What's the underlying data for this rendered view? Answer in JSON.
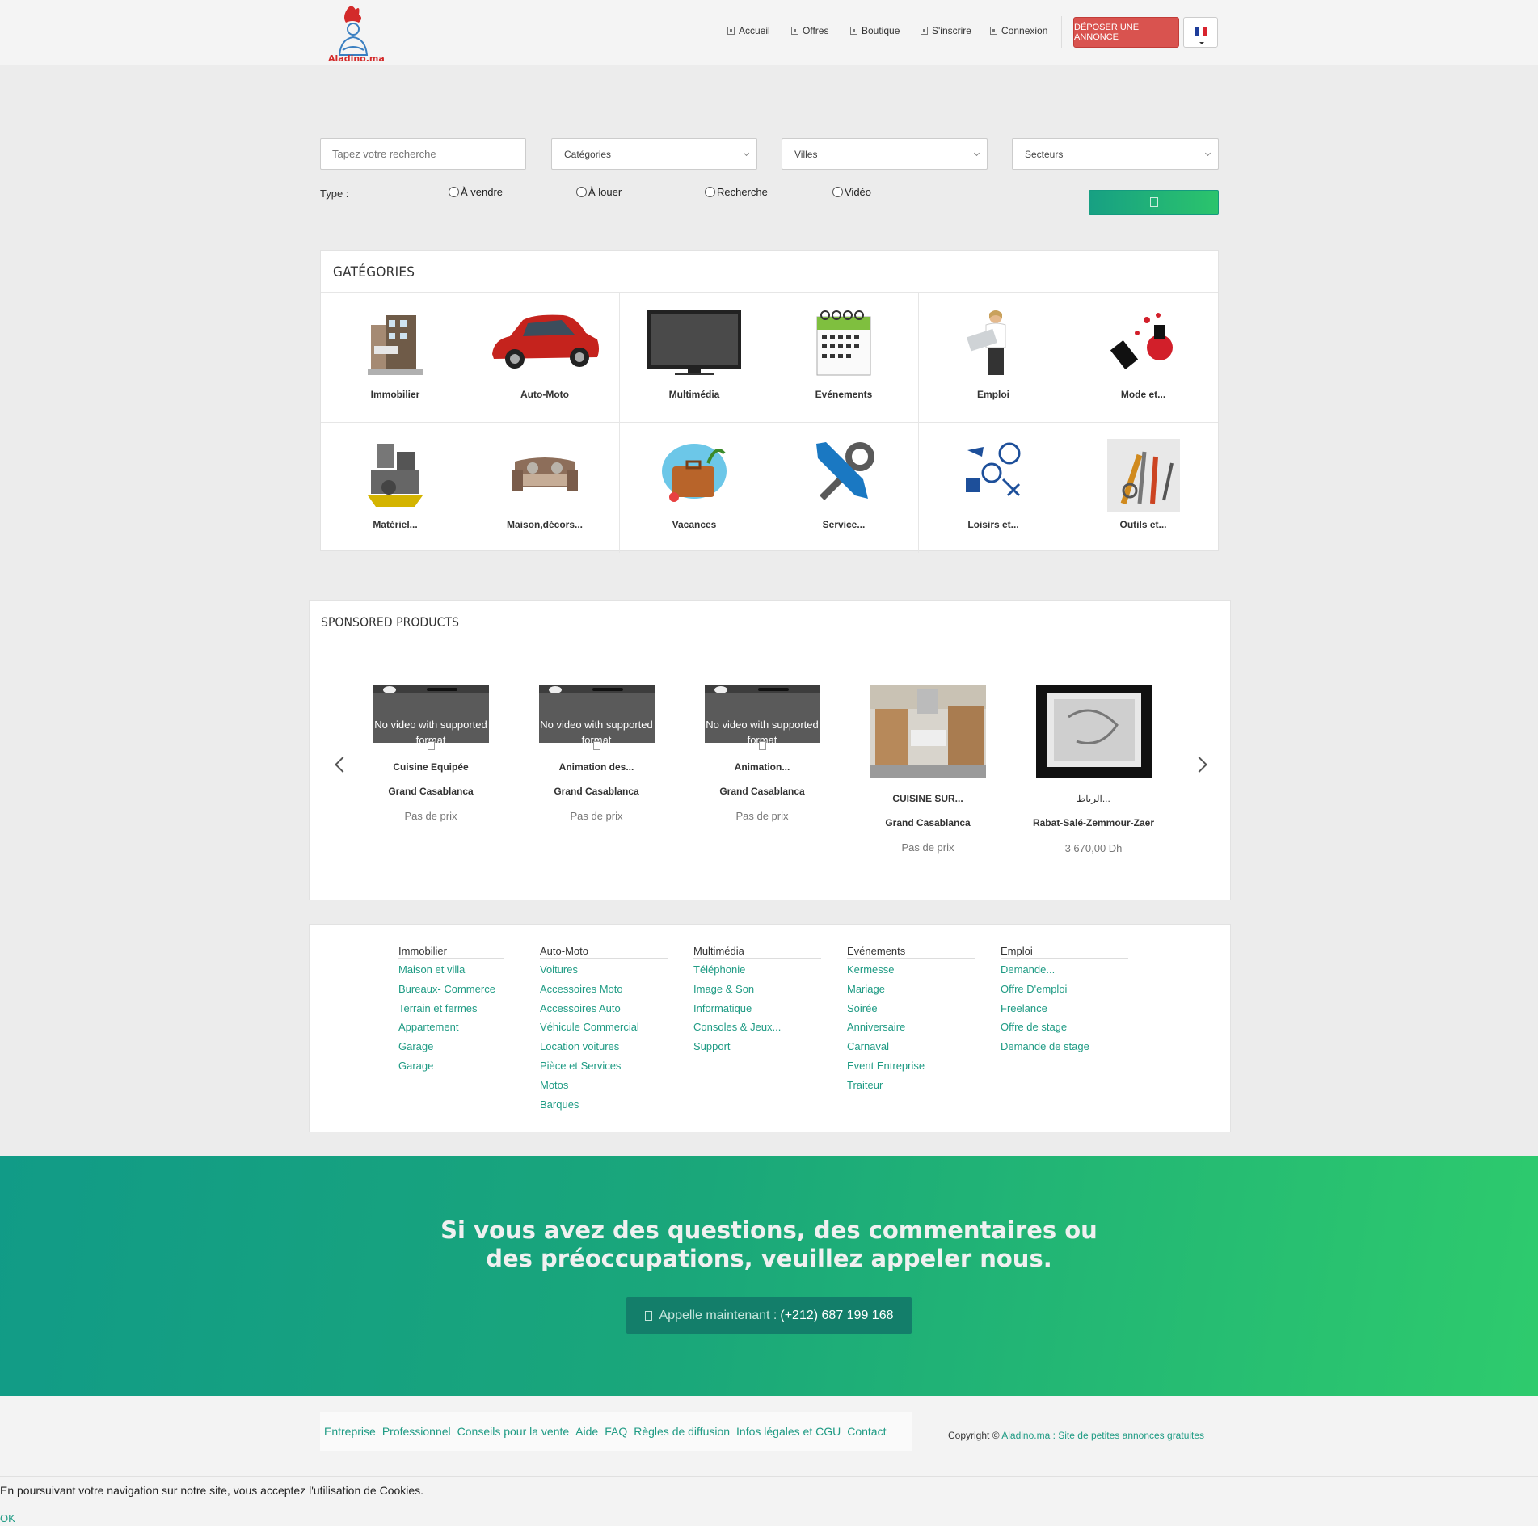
{
  "header": {
    "logo_text": "Aladino.ma",
    "nav": [
      "Accueil",
      "Offres",
      "Boutique",
      "S'inscrire",
      "Connexion"
    ],
    "post_button": "DÉPOSER UNE ANNONCE",
    "flag_colors": [
      "#1f3d9a",
      "#ffffff",
      "#d8242e"
    ]
  },
  "search": {
    "placeholder": "Tapez votre recherche",
    "categories": "Catégories",
    "cities": "Villes",
    "sectors": "Secteurs",
    "type_label": "Type :",
    "types": [
      "À vendre",
      "À louer",
      "Recherche",
      "Vidéo"
    ],
    "button_icon": "search-icon"
  },
  "categories": {
    "title": "GATÉGORIES",
    "items": [
      {
        "label": "Immobilier",
        "icon": "building-icon"
      },
      {
        "label": "Auto-Moto",
        "icon": "car-icon"
      },
      {
        "label": "Multimédia",
        "icon": "tv-icon"
      },
      {
        "label": "Evénements",
        "icon": "calendar-icon"
      },
      {
        "label": "Emploi",
        "icon": "businesswoman-icon"
      },
      {
        "label": "Mode et...",
        "icon": "nail-polish-icon"
      },
      {
        "label": "Matériel...",
        "icon": "machine-icon"
      },
      {
        "label": "Maison,décors...",
        "icon": "sofa-icon"
      },
      {
        "label": "Vacances",
        "icon": "suitcase-icon"
      },
      {
        "label": "Service...",
        "icon": "tools-icon"
      },
      {
        "label": "Loisirs et...",
        "icon": "leisure-icon"
      },
      {
        "label": "Outils et...",
        "icon": "hand-tools-icon"
      }
    ]
  },
  "sponsored": {
    "title_light": "SPONSORED",
    "title_bold": "PRODUCTS",
    "video_msg": "No video with supported format",
    "items": [
      {
        "name": "Cuisine Equipée",
        "city": "Grand Casablanca",
        "price": "Pas de prix",
        "media": "video"
      },
      {
        "name": "Animation des...",
        "city": "Grand Casablanca",
        "price": "Pas de prix",
        "media": "video"
      },
      {
        "name": "Animation...",
        "city": "Grand Casablanca",
        "price": "Pas de prix",
        "media": "video"
      },
      {
        "name": "CUISINE SUR...",
        "city": "Grand Casablanca",
        "price": "Pas de prix",
        "media": "kitchen-photo"
      },
      {
        "name": "الرباط...",
        "city": "Rabat-Salé-Zemmour-Zaer",
        "price": "3 670,00 Dh",
        "media": "device-photo"
      }
    ]
  },
  "footer_links": [
    {
      "heading": "Immobilier",
      "links": [
        "Maison et villa",
        "Bureaux- Commerce",
        "Terrain et fermes",
        "Appartement",
        "Garage",
        "Garage"
      ]
    },
    {
      "heading": "Auto-Moto",
      "links": [
        "Voitures",
        "Accessoires Moto",
        "Accessoires Auto",
        "Véhicule Commercial",
        "Location voitures",
        "Pièce et Services",
        "Motos",
        "Barques"
      ]
    },
    {
      "heading": "Multimédia",
      "links": [
        "Téléphonie",
        "Image & Son",
        "Informatique",
        "Consoles & Jeux...",
        "Support"
      ]
    },
    {
      "heading": "Evénements",
      "links": [
        "Kermesse",
        "Mariage",
        "Soirée",
        "Anniversaire",
        "Carnaval",
        "Event Entreprise",
        "Traiteur"
      ]
    },
    {
      "heading": "Emploi",
      "links": [
        "Demande...",
        "Offre D'emploi",
        "Freelance",
        "Offre de stage",
        "Demande de stage"
      ]
    }
  ],
  "contact": {
    "title": "Si vous avez des questions, des commentaires ou des préoccupations, veuillez appeler nous.",
    "call_prefix": "Appelle maintenant :",
    "phone": "(+212) 687 199 168"
  },
  "bottom": {
    "links": [
      "Entreprise",
      "Professionnel",
      "Conseils pour la vente",
      "Aide",
      "FAQ",
      "Règles de diffusion",
      "Infos légales et CGU",
      "Contact"
    ],
    "copyright_prefix": "Copyright ©",
    "copyright_link": "Aladino.ma : Site de petites annonces gratuites"
  },
  "cookie": {
    "text": "En poursuivant votre navigation sur notre site, vous acceptez l'utilisation de Cookies.",
    "ok": "OK"
  },
  "colors": {
    "accent": "#1f9b84",
    "post_button": "#d9534f",
    "band_start": "#119b87",
    "band_end": "#2ecb6d"
  }
}
